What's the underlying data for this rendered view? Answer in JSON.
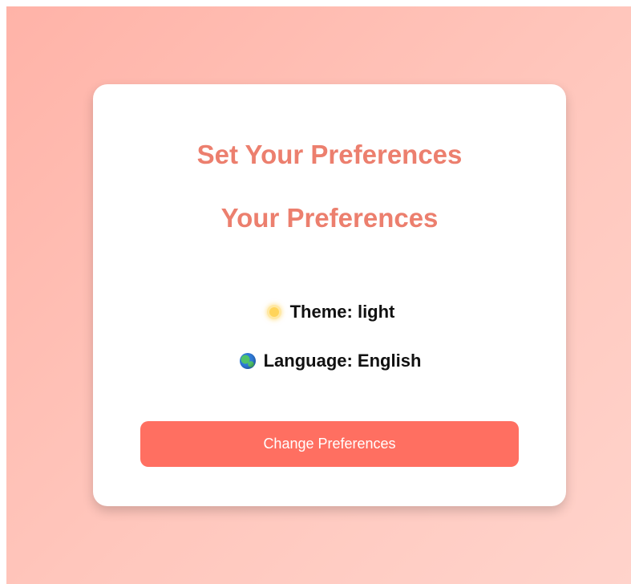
{
  "card": {
    "title": "Set Your Preferences",
    "subtitle": "Your Preferences",
    "preferences": [
      {
        "icon": "sun-icon",
        "label": "Theme: light"
      },
      {
        "icon": "globe-icon",
        "label": "Language: English"
      }
    ],
    "button_label": "Change Preferences"
  },
  "colors": {
    "accent": "#ec7f6e",
    "button": "#ff6f61",
    "background": "#ffb3a8"
  }
}
